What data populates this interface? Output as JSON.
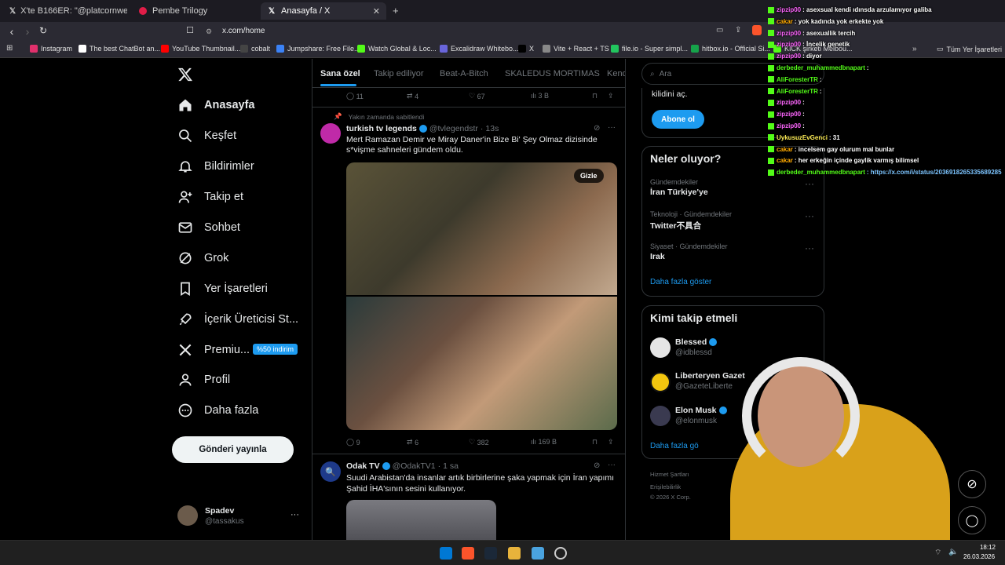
{
  "browser": {
    "tabs": [
      {
        "title": "X'te B166ER: \"@platcornweb 15 yıl d",
        "icon": "x-icon"
      },
      {
        "title": "Pembe Trilogy",
        "icon": "pink-circle-icon"
      },
      {
        "title": "Anasayfa / X",
        "icon": "x-icon"
      }
    ],
    "url": "x.com/home",
    "bookmarks": [
      {
        "label": "Instagram",
        "color": "#e1306c"
      },
      {
        "label": "The best ChatBot an...",
        "color": "#ffffff"
      },
      {
        "label": "YouTube Thumbnail...",
        "color": "#ff0000"
      },
      {
        "label": "cobalt",
        "color": "#444444"
      },
      {
        "label": "Jumpshare: Free File...",
        "color": "#3b82f6"
      },
      {
        "label": "Watch Global & Loc...",
        "color": "#53fc18"
      },
      {
        "label": "Excalidraw Whitebo...",
        "color": "#6965db"
      },
      {
        "label": "X",
        "color": "#000000"
      },
      {
        "label": "Vite + React + TS",
        "color": "#888888"
      },
      {
        "label": "file.io - Super simpl...",
        "color": "#22c55e"
      },
      {
        "label": "hitbox.io - Official Si...",
        "color": "#16a34a"
      },
      {
        "label": "KICK şirketi Melbou...",
        "color": "#53fc18"
      }
    ],
    "all_bookmarks": "Tüm Yer İşaretleri"
  },
  "sidebar": {
    "items": [
      {
        "label": "Anasayfa",
        "icon": "home-icon"
      },
      {
        "label": "Keşfet",
        "icon": "search-icon"
      },
      {
        "label": "Bildirimler",
        "icon": "bell-icon"
      },
      {
        "label": "Takip et",
        "icon": "add-user-icon"
      },
      {
        "label": "Sohbet",
        "icon": "mail-icon"
      },
      {
        "label": "Grok",
        "icon": "grok-icon"
      },
      {
        "label": "Yer İşaretleri",
        "icon": "bookmark-icon"
      },
      {
        "label": "İçerik Üreticisi St...",
        "icon": "rocket-icon"
      },
      {
        "label": "Premiu...",
        "icon": "x-icon"
      },
      {
        "label": "Profil",
        "icon": "person-icon"
      },
      {
        "label": "Daha fazla",
        "icon": "more-circle-icon"
      }
    ],
    "premium_badge": "%50 indirim",
    "post_button": "Gönderi yayınla",
    "account": {
      "name": "Spadev",
      "handle": "@tassakus"
    }
  },
  "feed": {
    "tabs": [
      "Sana özel",
      "Takip ediliyor",
      "Beat-A-Bitch",
      "SKALEDUS MORTIMAS",
      "Kend"
    ],
    "prev_stats": {
      "replies": "11",
      "reposts": "4",
      "likes": "67",
      "views": "3 B"
    },
    "tweet1": {
      "pinned_label": "Yakın zamanda sabitlendi",
      "name": "turkish tv legends",
      "handle": "@tvlegendstr",
      "time": "13s",
      "text": "Mert Ramazan Demir ve Miray Daner'in Bize Bi' Şey Olmaz dizisinde s*vişme sahneleri gündem oldu.",
      "hide_label": "Gizle",
      "stats": {
        "replies": "9",
        "reposts": "6",
        "likes": "382",
        "views": "169 B"
      }
    },
    "tweet2": {
      "name": "Odak TV",
      "handle": "@OdakTV1",
      "time": "1 sa",
      "text": "Suudi Arabistan'da  insanlar artık birbirlerine şaka yapmak için İran yapımı Şahid  İHA'sının  sesini kullanıyor."
    }
  },
  "right": {
    "search_placeholder": "Ara",
    "premium_text": "kilidini aç.",
    "subscribe_button": "Abone ol",
    "trends_title": "Neler oluyor?",
    "trends": [
      {
        "category": "Gündemdekiler",
        "name": "İran Türkiye'ye"
      },
      {
        "category": "Teknoloji · Gündemdekiler",
        "name": "Twitter不具合"
      },
      {
        "category": "Siyaset · Gündemdekiler",
        "name": "Irak"
      }
    ],
    "show_more": "Daha fazla göster",
    "follow_title": "Kimi takip etmeli",
    "suggestions": [
      {
        "name": "Blessed",
        "handle": "@idblessd"
      },
      {
        "name": "Liberteryen Gazet",
        "handle": "@GazeteLiberte"
      },
      {
        "name": "Elon Musk",
        "handle": "@elonmusk"
      }
    ],
    "show_more_2": "Daha fazla gö",
    "footer": [
      "Hizmet Şartları",
      "Erişilebilirlik",
      "© 2026 X Corp."
    ]
  },
  "chat": [
    {
      "user": "zipzip00",
      "color": "#ff66ff",
      "msg": ": asexsual kendi ıdınsda arzulamıyor galiba"
    },
    {
      "user": "cakar",
      "color": "#ffaa00",
      "msg": ": yok kadında yok erkekte yok"
    },
    {
      "user": "zipzip00",
      "color": "#ff66ff",
      "msg": ": asexuallik tercih"
    },
    {
      "user": "zipzip00",
      "color": "#ff66ff",
      "msg": ": İncelik genetik"
    },
    {
      "user": "zipzip00",
      "color": "#ff66ff",
      "msg": ": diyor"
    },
    {
      "user": "derbeder_muhammedbnapart",
      "color": "#53fc18",
      "msg": ":"
    },
    {
      "user": "AliForesterTR",
      "color": "#53fc18",
      "msg": ":"
    },
    {
      "user": "AliForesterTR",
      "color": "#53fc18",
      "msg": ":"
    },
    {
      "user": "zipzip00",
      "color": "#ff66ff",
      "msg": ":"
    },
    {
      "user": "zipzip00",
      "color": "#ff66ff",
      "msg": ":"
    },
    {
      "user": "zipzip00",
      "color": "#ff66ff",
      "msg": ":"
    },
    {
      "user": "UykusuzEvGenci",
      "color": "#ffee55",
      "msg": ": 31"
    },
    {
      "user": "cakar",
      "color": "#ffaa00",
      "msg": ": incelsem gay olurum mal bunlar"
    },
    {
      "user": "cakar",
      "color": "#ffaa00",
      "msg": ": her erkeğin içinde gaylik varmış bilimsel"
    },
    {
      "user": "derbeder_muhammedbnapart",
      "color": "#53fc18",
      "msg": ": https://x.com/i/status/2036918265335689285"
    }
  ],
  "taskbar": {
    "time": "18:12",
    "date": "26.03.2026"
  }
}
